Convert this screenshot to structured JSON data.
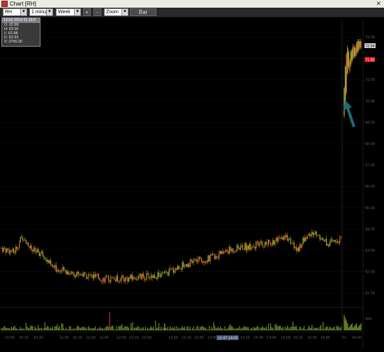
{
  "window": {
    "title": "Chart [RH]",
    "close_glyph": "✕"
  },
  "toolbar": {
    "symbol_value": "RH",
    "interval_value": "1 minute",
    "range_value": "Week",
    "plus_label": "+",
    "minus_label": "-",
    "zoom_value": "Zoom",
    "bar_label": "Bar"
  },
  "info_box": {
    "header": "12:02 2014 11:16:0",
    "open": "O: 62.88",
    "high": "H: 63.00",
    "low": "L: 62.88",
    "close": "C: 62.93",
    "volume": "V: 2766.00"
  },
  "price_axis": {
    "ticks": [
      "73.00",
      "72.00",
      "71.00",
      "70.00",
      "69.00",
      "68.00",
      "67.00",
      "66.00",
      "65.00",
      "64.00",
      "63.00",
      "62.00",
      "61.00"
    ],
    "last_price_label": "72.64",
    "marker_label": "71.82"
  },
  "volume_axis": {
    "label": "50K"
  },
  "time_axis": {
    "labels": [
      "10:00",
      "10:15",
      "10:30",
      "11:00",
      "11:15",
      "11:30",
      "11:45",
      "12:00",
      "12:15",
      "12:30",
      "13:00",
      "13:15",
      "13:30",
      "13:45",
      "14:00",
      "14:15",
      "14:30",
      "14:45",
      "15:00",
      "15:15",
      "15:30",
      "15:45",
      "Fri",
      "09:45"
    ],
    "highlight_label": "13:47:14:00"
  },
  "colors": {
    "background": "#000000",
    "bull_candle": "#c9a227",
    "bear_candle": "#e0663c",
    "green_candle": "#8fc23a",
    "volume_bar": "#6a8a2a",
    "volume_spike": "#c0392b",
    "arrow": "#1f6a7a",
    "axis_text": "#5e5e5e",
    "marker_red": "#e01010"
  },
  "icons": {
    "app": "chart-app-icon",
    "arrow": "annotation-arrow-icon"
  }
}
